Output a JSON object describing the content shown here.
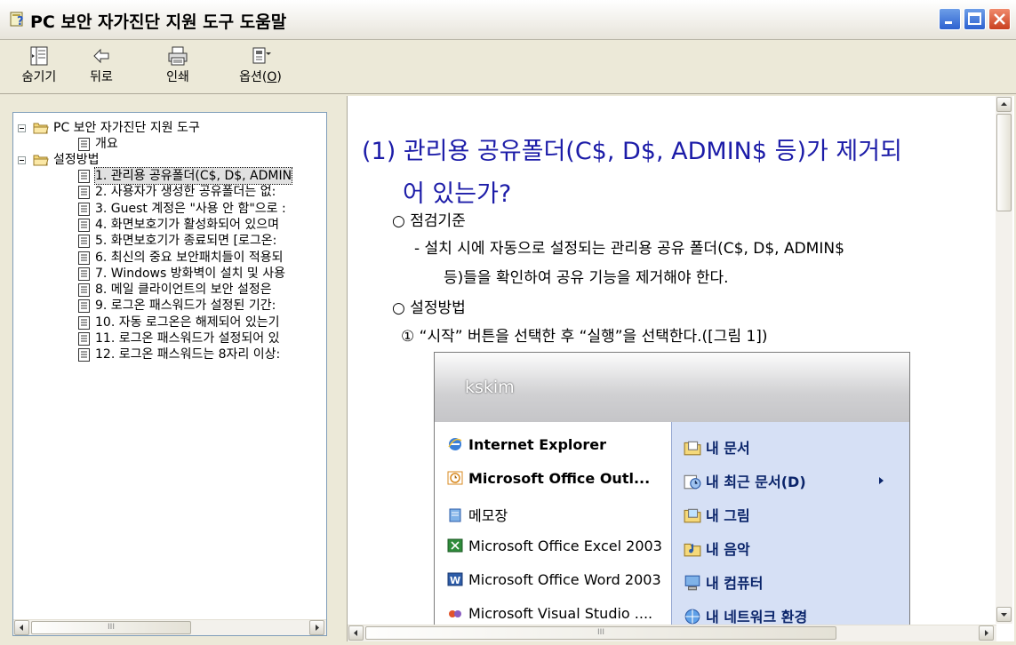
{
  "window": {
    "title": "PC 보안 자가진단 지원 도구 도움말",
    "colors": {
      "title_text": "#000000",
      "heading": "#1c1ca8",
      "accent": "#2d62d0",
      "close": "#c94020"
    }
  },
  "toolbar": {
    "hide_label": "숨기기",
    "back_label": "뒤로",
    "print_label": "인쇄",
    "options_label": "옵션(",
    "options_accel": "O",
    "options_close": ")"
  },
  "tree": {
    "root_label": "PC 보안 자가진단 지원 도구",
    "overview_label": "개요",
    "settings_label": "설정방법",
    "items": [
      "1. 관리용 공유폴더(C$, D$, ADMIN",
      "2. 사용자가 생성한 공유폴더는 없:",
      "3. Guest 계정은 \"사용 안 함\"으로 :",
      "4. 화면보호기가 활성화되어 있으며",
      "5. 화면보호기가 종료되면 [로그온:",
      "6. 최신의 중요 보안패치들이 적용되",
      "7. Windows 방화벽이 설치 및 사용",
      "8. 메일 클라이언트의 보안 설정은",
      "9. 로그온 패스워드가 설정된 기간:",
      "10. 자동 로그온은 해제되어 있는기",
      "11. 로그온 패스워드가 설정되어 있",
      "12. 로그온 패스워드는 8자리 이상:"
    ],
    "scroll_mark": "III"
  },
  "content": {
    "heading_line1": "(1) 관리용 공유폴더(C$, D$, ADMIN$ 등)가 제거되",
    "heading_line2": "어 있는가?",
    "criteria_title": "○ 점검기준",
    "criteria_line1": "- 설치 시에 자동으로 설정되는 관리용 공유 폴더(C$, D$, ADMIN$",
    "criteria_line2": "등)들을 확인하여 공유 기능을 제거해야 한다.",
    "method_title": "○ 설정방법",
    "step1": "① “시작” 버튼을 선택한 후 “실행”을 선택한다.([그림 1])",
    "scroll_mark": "III"
  },
  "startmenu": {
    "user": "kskim",
    "left_items": [
      {
        "label": "Internet Explorer",
        "bold": true,
        "icon": "internet-explorer-icon"
      },
      {
        "label": "Microsoft Office Outl...",
        "bold": true,
        "icon": "outlook-icon"
      },
      {
        "label": "메모장",
        "bold": false,
        "icon": "notepad-icon"
      },
      {
        "label": "Microsoft Office Excel 2003",
        "bold": false,
        "icon": "excel-icon"
      },
      {
        "label": "Microsoft Office Word 2003",
        "bold": false,
        "icon": "word-icon"
      },
      {
        "label": "Microsoft Visual Studio ....",
        "bold": false,
        "icon": "visual-studio-icon"
      }
    ],
    "right_items": [
      {
        "label": "내 문서",
        "icon": "my-documents-icon"
      },
      {
        "label": "내 최근 문서(D)",
        "icon": "recent-documents-icon"
      },
      {
        "label": "내 그림",
        "icon": "my-pictures-icon"
      },
      {
        "label": "내 음악",
        "icon": "my-music-icon"
      },
      {
        "label": "내 컴퓨터",
        "icon": "my-computer-icon"
      },
      {
        "label": "내 네트워크 환경",
        "icon": "network-icon"
      }
    ]
  }
}
